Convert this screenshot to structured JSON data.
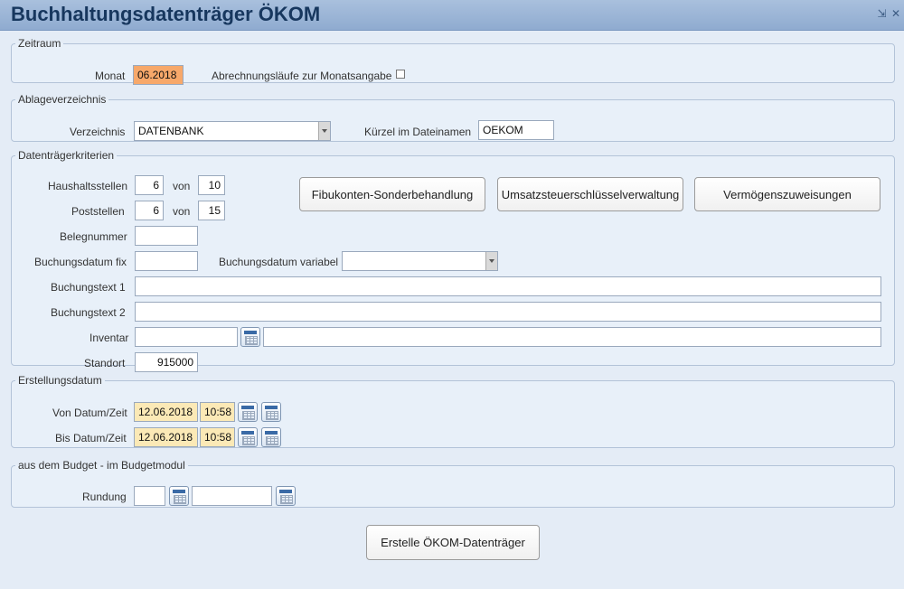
{
  "window": {
    "title": "Buchhaltungsdatenträger ÖKOM",
    "minimize_glyph": "⇲",
    "close_glyph": "✕"
  },
  "zeitraum": {
    "legend": "Zeitraum",
    "monat_label": "Monat",
    "monat_value": "06.2018",
    "abrechnungslaeufe_label": "Abrechnungsläufe zur Monatsangabe",
    "abrechnungslaeufe_checked": false
  },
  "ablage": {
    "legend": "Ablageverzeichnis",
    "verzeichnis_label": "Verzeichnis",
    "verzeichnis_value": "DATENBANK",
    "kuerzel_label": "Kürzel im Dateinamen",
    "kuerzel_value": "OEKOM"
  },
  "kriterien": {
    "legend": "Datenträgerkriterien",
    "haushaltsstellen_label": "Haushaltsstellen",
    "haushaltsstellen_value": "6",
    "haushaltsstellen_von_label": "von",
    "haushaltsstellen_total": "10",
    "poststellen_label": "Poststellen",
    "poststellen_value": "6",
    "poststellen_von_label": "von",
    "poststellen_total": "15",
    "belegnummer_label": "Belegnummer",
    "belegnummer_value": "",
    "buchungsdatum_fix_label": "Buchungsdatum fix",
    "buchungsdatum_fix_value": "",
    "buchungsdatum_variabel_label": "Buchungsdatum variabel",
    "buchungsdatum_variabel_value": "",
    "buchungstext1_label": "Buchungstext 1",
    "buchungstext1_value": "",
    "buchungstext2_label": "Buchungstext 2",
    "buchungstext2_value": "",
    "inventar_label": "Inventar",
    "inventar_value": "",
    "inventar_desc_value": "",
    "standort_label": "Standort",
    "standort_value": "915000",
    "btn_fibukonten": "Fibukonten-Sonderbehandlung",
    "btn_umsatzsteuer": "Umsatzsteuerschlüsselverwaltung",
    "btn_vermoegen": "Vermögenszuweisungen"
  },
  "erstellung": {
    "legend": "Erstellungsdatum",
    "von_label": "Von Datum/Zeit",
    "von_date": "12.06.2018",
    "von_time": "10:58",
    "bis_label": "Bis Datum/Zeit",
    "bis_date": "12.06.2018",
    "bis_time": "10:58"
  },
  "budget": {
    "legend": "aus dem Budget - im Budgetmodul",
    "rundung_label": "Rundung",
    "rundung_value": "",
    "rundung_desc_value": ""
  },
  "actions": {
    "create_label": "Erstelle ÖKOM-Datenträger"
  },
  "colors": {
    "accent_orange": "#f7a86a",
    "date_beige": "#fbe9b6",
    "title_blue": "#17375e"
  }
}
